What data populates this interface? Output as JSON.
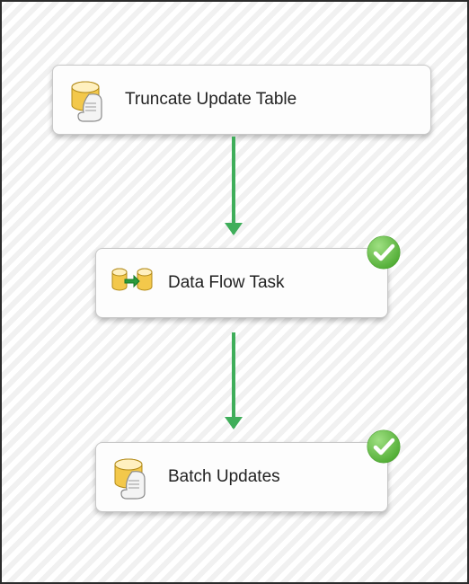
{
  "tasks": [
    {
      "id": "truncate-update-table",
      "label": "Truncate Update Table",
      "icon": "sql-script-icon",
      "status": "none"
    },
    {
      "id": "data-flow-task",
      "label": "Data Flow Task",
      "icon": "data-flow-icon",
      "status": "success"
    },
    {
      "id": "batch-updates",
      "label": "Batch Updates",
      "icon": "sql-script-icon",
      "status": "success"
    }
  ],
  "arrow_color": "#3fae5a",
  "status_colors": {
    "success": "#58b748"
  }
}
